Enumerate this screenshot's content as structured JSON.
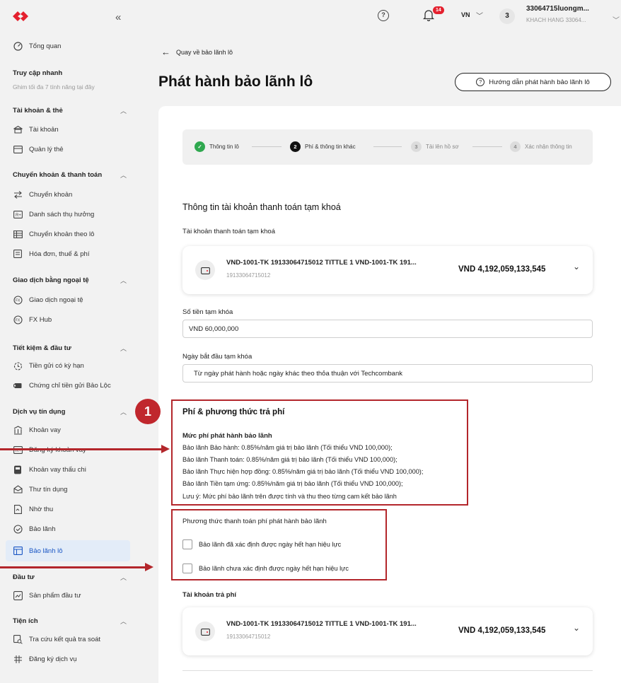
{
  "colors": {
    "brand": "#e4202e",
    "accent_blue": "#1a56c4",
    "annotation_red": "#b3262b",
    "success_green": "#2fa84f"
  },
  "sidebar": {
    "collapse_icon": "double-chevron-left-icon",
    "overview": "Tổng quan",
    "quick_access": {
      "title": "Truy cập nhanh",
      "hint": "Ghim tối đa 7 tính năng tại đây"
    },
    "groups": [
      {
        "title": "Tài khoản & thẻ",
        "items": [
          "Tài khoản",
          "Quản lý thẻ"
        ]
      },
      {
        "title": "Chuyển khoản & thanh toán",
        "items": [
          "Chuyển khoản",
          "Danh sách thụ hưởng",
          "Chuyển khoản theo lô",
          "Hóa đơn, thuế & phí"
        ]
      },
      {
        "title": "Giao dịch bằng ngoại tệ",
        "items": [
          "Giao dịch ngoại tệ",
          "FX Hub"
        ]
      },
      {
        "title": "Tiết kiệm & đầu tư",
        "items": [
          "Tiền gửi có kỳ hạn",
          "Chứng chỉ tiền gửi Bảo Lộc"
        ]
      },
      {
        "title": "Dịch vụ tín dụng",
        "items": [
          "Khoản vay",
          "Đăng ký khoản vay",
          "Khoản vay thấu chi",
          "Thư tín dụng",
          "Nhờ thu",
          "Bảo lãnh",
          "Bảo lãnh lô"
        ]
      },
      {
        "title": "Đầu tư",
        "items": [
          "Sản phẩm đầu tư"
        ]
      },
      {
        "title": "Tiện ích",
        "items": [
          "Tra cứu kết quả tra soát",
          "Đăng ký dịch vụ"
        ]
      }
    ]
  },
  "topbar": {
    "notification_count": "14",
    "language": "VN",
    "avatar_initial": "3",
    "username": "33064715luongm...",
    "user_subtitle": "KHACH HANG 33064..."
  },
  "header": {
    "back_label": "Quay về bảo lãnh lô",
    "title": "Phát hành bảo lãnh lô",
    "guide_button": "Hướng dẫn phát hành bảo lãnh lô"
  },
  "stepper": {
    "steps": [
      {
        "num": "✓",
        "label": "Thông tin lô",
        "state": "done"
      },
      {
        "num": "2",
        "label": "Phí & thông tin khác",
        "state": "current"
      },
      {
        "num": "3",
        "label": "Tải lên hồ sơ",
        "state": "todo"
      },
      {
        "num": "4",
        "label": "Xác nhận thông tin",
        "state": "todo"
      }
    ]
  },
  "hold_section": {
    "title": "Thông tin tài khoản thanh toán tạm khoá",
    "account_label": "Tài khoản thanh toán tạm khoá",
    "account": {
      "name": "VND-1001-TK 19133064715012 TITTLE 1 VND-1001-TK 191...",
      "number": "19133064715012",
      "balance": "VND  4,192,059,133,545"
    },
    "amount_label": "Số tiền tạm khóa",
    "amount_value": "VND 60,000,000",
    "start_date_label": "Ngày bắt đầu tạm khóa",
    "start_date_value": "Từ ngày phát hành hoặc ngày khác theo thỏa thuận với Techcombank"
  },
  "fee_section": {
    "callout_number": "1",
    "title": "Phí & phương thức trả phí",
    "rate_label": "Mức phí phát hành bảo lãnh",
    "rate_lines": [
      "Bảo lãnh Bảo hành: 0.85%/năm giá trị bảo lãnh (Tối thiểu VND 100,000);",
      "Bảo lãnh Thanh toán: 0.85%/năm giá trị bảo lãnh (Tối thiểu VND 100,000);",
      "Bảo lãnh Thực hiện hợp đồng: 0.85%/năm giá trị bảo lãnh (Tối thiểu VND 100,000);",
      "Bảo lãnh Tiền tạm ứng: 0.85%/năm giá trị bảo lãnh (Tối thiểu VND 100,000);",
      "Lưu ý: Mức phí bảo lãnh trên được tính và thu theo từng cam kết bảo lãnh"
    ],
    "method_label": "Phương thức thanh toán phí phát hành bảo lãnh",
    "options": [
      "Bảo lãnh đã xác định được ngày hết hạn hiệu lực",
      "Bảo lãnh chưa xác định được ngày hết hạn hiệu lực"
    ],
    "fee_account_label": "Tài khoản trả phí",
    "fee_account": {
      "name": "VND-1001-TK 19133064715012 TITTLE 1 VND-1001-TK 191...",
      "number": "19133064715012",
      "balance": "VND  4,192,059,133,545"
    }
  }
}
